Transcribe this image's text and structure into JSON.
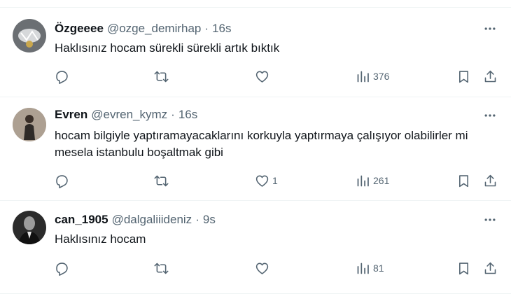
{
  "tweets": [
    {
      "name": "Özgeeee",
      "handle": "@ozge_demirhap",
      "separator": "·",
      "time": "16s",
      "text": "Haklısınız hocam sürekli sürekli artık bıktık",
      "reply_count": "",
      "retweet_count": "",
      "like_count": "",
      "views": "376",
      "avatar_color": "#6b6f73"
    },
    {
      "name": "Evren",
      "handle": "@evren_kymz",
      "separator": "·",
      "time": "16s",
      "text": "hocam bilgiyle yaptıramayacaklarını korkuyla yaptırmaya çalışıyor olabilirler mi mesela istanbulu boşaltmak gibi",
      "reply_count": "",
      "retweet_count": "",
      "like_count": "1",
      "views": "261",
      "avatar_color": "#8a7a6a"
    },
    {
      "name": "can_1905",
      "handle": "@dalgaliiideniz",
      "separator": "·",
      "time": "9s",
      "text": "Haklısınız hocam",
      "reply_count": "",
      "retweet_count": "",
      "like_count": "",
      "views": "81",
      "avatar_color": "#2b2b2b"
    }
  ],
  "colors": {
    "text_primary": "#0f1419",
    "text_secondary": "#536471",
    "divider": "#eff3f4"
  },
  "icons": [
    "more-icon",
    "reply-icon",
    "retweet-icon",
    "like-icon",
    "views-icon",
    "bookmark-icon",
    "share-icon"
  ]
}
